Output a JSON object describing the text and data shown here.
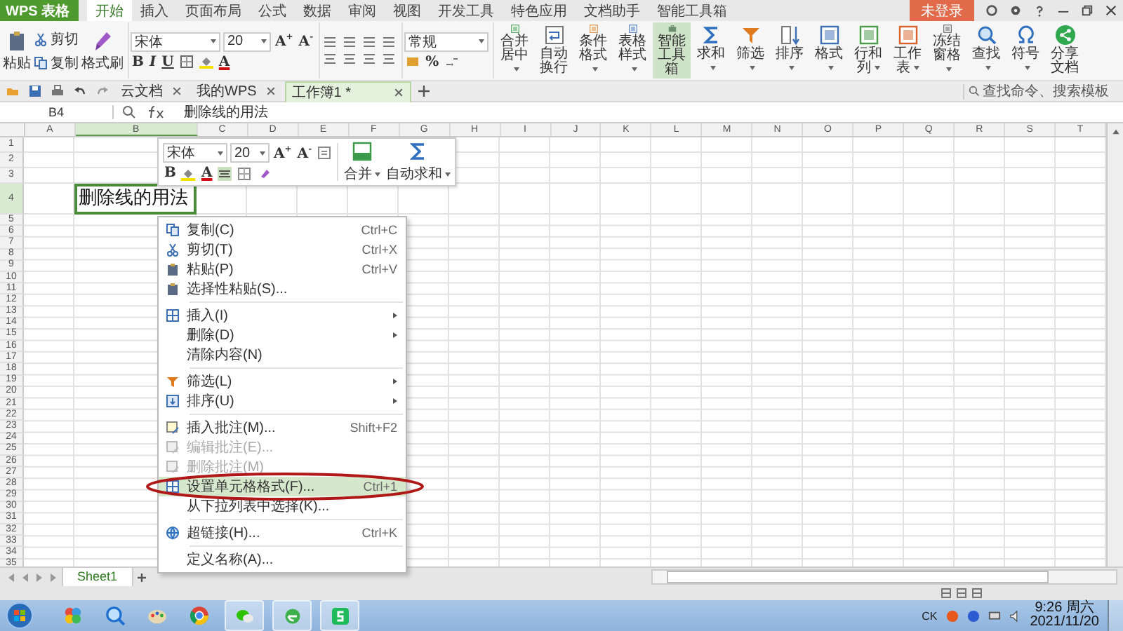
{
  "app_logo": "WPS 表格",
  "menu_tabs": [
    {
      "label": "开始",
      "selected": true
    },
    {
      "label": "插入",
      "selected": false
    },
    {
      "label": "页面布局",
      "selected": false
    },
    {
      "label": "公式",
      "selected": false
    },
    {
      "label": "数据",
      "selected": false
    },
    {
      "label": "审阅",
      "selected": false
    },
    {
      "label": "视图",
      "selected": false
    },
    {
      "label": "开发工具",
      "selected": false
    },
    {
      "label": "特色应用",
      "selected": false
    },
    {
      "label": "文档助手",
      "selected": false
    },
    {
      "label": "智能工具箱",
      "selected": false
    }
  ],
  "login_button": "未登录",
  "ribbon": {
    "clipboard": {
      "paste": "粘贴",
      "cut": "剪切",
      "copy": "复制",
      "format_painter": "格式刷"
    },
    "font": {
      "name": "宋体",
      "size": "20",
      "letters": [
        "B",
        "I",
        "U"
      ],
      "color_letter": "A",
      "grow": "A",
      "grow_sign": "+",
      "shrink": "A",
      "shrink_sign": "-"
    },
    "number_format": "常规",
    "percent": "%",
    "buttons": [
      {
        "label": "合并居中",
        "dropdown": true,
        "on": false
      },
      {
        "label": "自动换行",
        "dropdown": false,
        "on": false
      },
      {
        "label": "条件格式",
        "dropdown": true,
        "on": false
      },
      {
        "label": "表格样式",
        "dropdown": true,
        "on": false
      },
      {
        "label": "智能工具箱",
        "dropdown": false,
        "on": true
      },
      {
        "label": "求和",
        "dropdown": true,
        "on": false
      },
      {
        "label": "筛选",
        "dropdown": true,
        "on": false
      },
      {
        "label": "排序",
        "dropdown": true,
        "on": false
      },
      {
        "label": "格式",
        "dropdown": true,
        "on": false
      },
      {
        "label": "行和列",
        "dropdown": true,
        "on": false
      },
      {
        "label": "工作表",
        "dropdown": true,
        "on": false
      },
      {
        "label": "冻结窗格",
        "dropdown": true,
        "on": false
      },
      {
        "label": "查找",
        "dropdown": true,
        "on": false
      },
      {
        "label": "符号",
        "dropdown": true,
        "on": false
      },
      {
        "label": "分享文档",
        "dropdown": false,
        "on": false
      }
    ]
  },
  "document_tabs": [
    {
      "label": "云文档",
      "selected": false
    },
    {
      "label": "我的WPS",
      "selected": false
    },
    {
      "label": "工作簿1 *",
      "selected": true
    }
  ],
  "command_search": {
    "placeholder": "查找命令、搜索模板"
  },
  "formula_bar": {
    "cell_ref": "B4",
    "formula": "删除线的用法"
  },
  "sheet": {
    "columns": [
      {
        "label": "A",
        "selected": false
      },
      {
        "label": "B",
        "selected": true
      },
      {
        "label": "C",
        "selected": false
      },
      {
        "label": "D",
        "selected": false
      },
      {
        "label": "E",
        "selected": false
      },
      {
        "label": "F",
        "selected": false
      },
      {
        "label": "G",
        "selected": false
      },
      {
        "label": "H",
        "selected": false
      },
      {
        "label": "I",
        "selected": false
      },
      {
        "label": "J",
        "selected": false
      },
      {
        "label": "K",
        "selected": false
      },
      {
        "label": "L",
        "selected": false
      },
      {
        "label": "M",
        "selected": false
      },
      {
        "label": "N",
        "selected": false
      },
      {
        "label": "O",
        "selected": false
      },
      {
        "label": "P",
        "selected": false
      },
      {
        "label": "Q",
        "selected": false
      },
      {
        "label": "R",
        "selected": false
      },
      {
        "label": "S",
        "selected": false
      },
      {
        "label": "T",
        "selected": false
      }
    ],
    "rows": [
      {
        "label": "1",
        "selected": false
      },
      {
        "label": "2",
        "selected": false
      },
      {
        "label": "3",
        "selected": false
      },
      {
        "label": "4",
        "selected": true,
        "value": "删除线的用法"
      },
      {
        "label": "5",
        "selected": false
      },
      {
        "label": "6",
        "selected": false
      },
      {
        "label": "7",
        "selected": false
      },
      {
        "label": "8",
        "selected": false
      },
      {
        "label": "9",
        "selected": false
      },
      {
        "label": "10",
        "selected": false
      },
      {
        "label": "11",
        "selected": false
      },
      {
        "label": "12",
        "selected": false
      },
      {
        "label": "13",
        "selected": false
      },
      {
        "label": "14",
        "selected": false
      },
      {
        "label": "15",
        "selected": false
      },
      {
        "label": "16",
        "selected": false
      },
      {
        "label": "17",
        "selected": false
      },
      {
        "label": "18",
        "selected": false
      },
      {
        "label": "19",
        "selected": false
      },
      {
        "label": "20",
        "selected": false
      },
      {
        "label": "21",
        "selected": false
      },
      {
        "label": "22",
        "selected": false
      },
      {
        "label": "23",
        "selected": false
      },
      {
        "label": "24",
        "selected": false
      },
      {
        "label": "25",
        "selected": false
      },
      {
        "label": "26",
        "selected": false
      },
      {
        "label": "27",
        "selected": false
      },
      {
        "label": "28",
        "selected": false
      },
      {
        "label": "29",
        "selected": false
      },
      {
        "label": "30",
        "selected": false
      },
      {
        "label": "31",
        "selected": false
      },
      {
        "label": "32",
        "selected": false
      },
      {
        "label": "33",
        "selected": false
      },
      {
        "label": "34",
        "selected": false
      },
      {
        "label": "35",
        "selected": false
      }
    ]
  },
  "mini_toolbar": {
    "font": "宋体",
    "size": "20",
    "grow": "A",
    "grow_sign": "+",
    "shrink": "A",
    "shrink_sign": "-",
    "bold": "B",
    "color_letter": "A",
    "merge": "合并",
    "autosum": "自动求和"
  },
  "context_menu": [
    {
      "kind": "item",
      "label": "复制(C)",
      "shortcut": "Ctrl+C",
      "submenu": false,
      "disabled": false,
      "selected": false
    },
    {
      "kind": "item",
      "label": "剪切(T)",
      "shortcut": "Ctrl+X",
      "submenu": false,
      "disabled": false,
      "selected": false
    },
    {
      "kind": "item",
      "label": "粘贴(P)",
      "shortcut": "Ctrl+V",
      "submenu": false,
      "disabled": false,
      "selected": false
    },
    {
      "kind": "item",
      "label": "选择性粘贴(S)...",
      "submenu": false,
      "disabled": false,
      "selected": false
    },
    {
      "kind": "separator"
    },
    {
      "kind": "item",
      "label": "插入(I)",
      "submenu": true,
      "disabled": false,
      "selected": false
    },
    {
      "kind": "item",
      "label": "删除(D)",
      "submenu": true,
      "disabled": false,
      "selected": false
    },
    {
      "kind": "item",
      "label": "清除内容(N)",
      "submenu": false,
      "disabled": false,
      "selected": false
    },
    {
      "kind": "separator"
    },
    {
      "kind": "item",
      "label": "筛选(L)",
      "submenu": true,
      "disabled": false,
      "selected": false
    },
    {
      "kind": "item",
      "label": "排序(U)",
      "submenu": true,
      "disabled": false,
      "selected": false
    },
    {
      "kind": "separator"
    },
    {
      "kind": "item",
      "label": "插入批注(M)...",
      "shortcut": "Shift+F2",
      "submenu": false,
      "disabled": false,
      "selected": false
    },
    {
      "kind": "item",
      "label": "编辑批注(E)...",
      "submenu": false,
      "disabled": true,
      "selected": false
    },
    {
      "kind": "item",
      "label": "删除批注(M)",
      "submenu": false,
      "disabled": true,
      "selected": false
    },
    {
      "kind": "item",
      "label": "设置单元格格式(F)...",
      "shortcut": "Ctrl+1",
      "submenu": false,
      "disabled": false,
      "selected": true
    },
    {
      "kind": "item",
      "label": "从下拉列表中选择(K)...",
      "submenu": false,
      "disabled": false,
      "selected": false
    },
    {
      "kind": "separator"
    },
    {
      "kind": "item",
      "label": "超链接(H)...",
      "shortcut": "Ctrl+K",
      "submenu": false,
      "disabled": false,
      "selected": false
    },
    {
      "kind": "separator"
    },
    {
      "kind": "item",
      "label": "定义名称(A)...",
      "submenu": false,
      "disabled": false,
      "selected": false
    }
  ],
  "sheet_tabs": [
    {
      "label": "Sheet1",
      "selected": true
    }
  ],
  "taskbar": {
    "input_indicator": "CK",
    "time": "9:26 周六",
    "date": "2021/11/20"
  }
}
